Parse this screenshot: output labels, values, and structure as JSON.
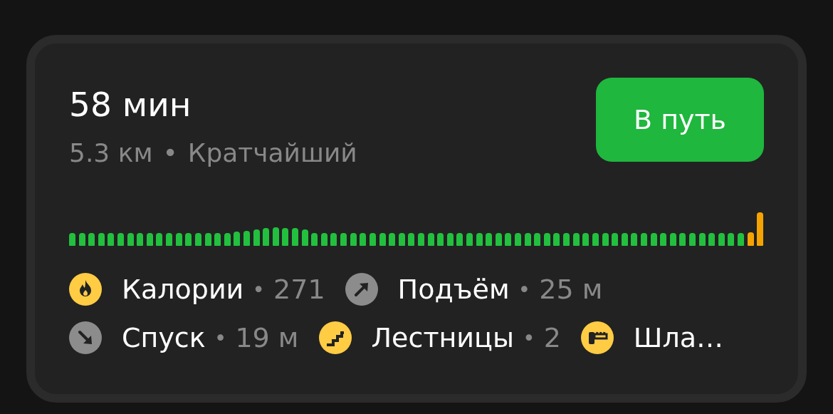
{
  "route": {
    "duration": "58 мин",
    "distance": "5.3 км",
    "separator": "•",
    "route_type": "Кратчайший"
  },
  "go_button": {
    "label": "В путь"
  },
  "stats": [
    {
      "kind": "fire",
      "label": "Калории",
      "separator": "•",
      "value": "271",
      "color": "#ffcc44"
    },
    {
      "kind": "ascent",
      "label": "Подъём",
      "separator": "•",
      "value": "25 м",
      "color": "#8c8c8c"
    },
    {
      "kind": "descent",
      "label": "Спуск",
      "separator": "•",
      "value": "19 м",
      "color": "#8c8c8c"
    },
    {
      "kind": "stairs",
      "label": "Лестницы",
      "separator": "•",
      "value": "2",
      "color": "#ffcc44"
    },
    {
      "kind": "barrier",
      "label": "Шла…",
      "color": "#ffcc44"
    }
  ]
}
